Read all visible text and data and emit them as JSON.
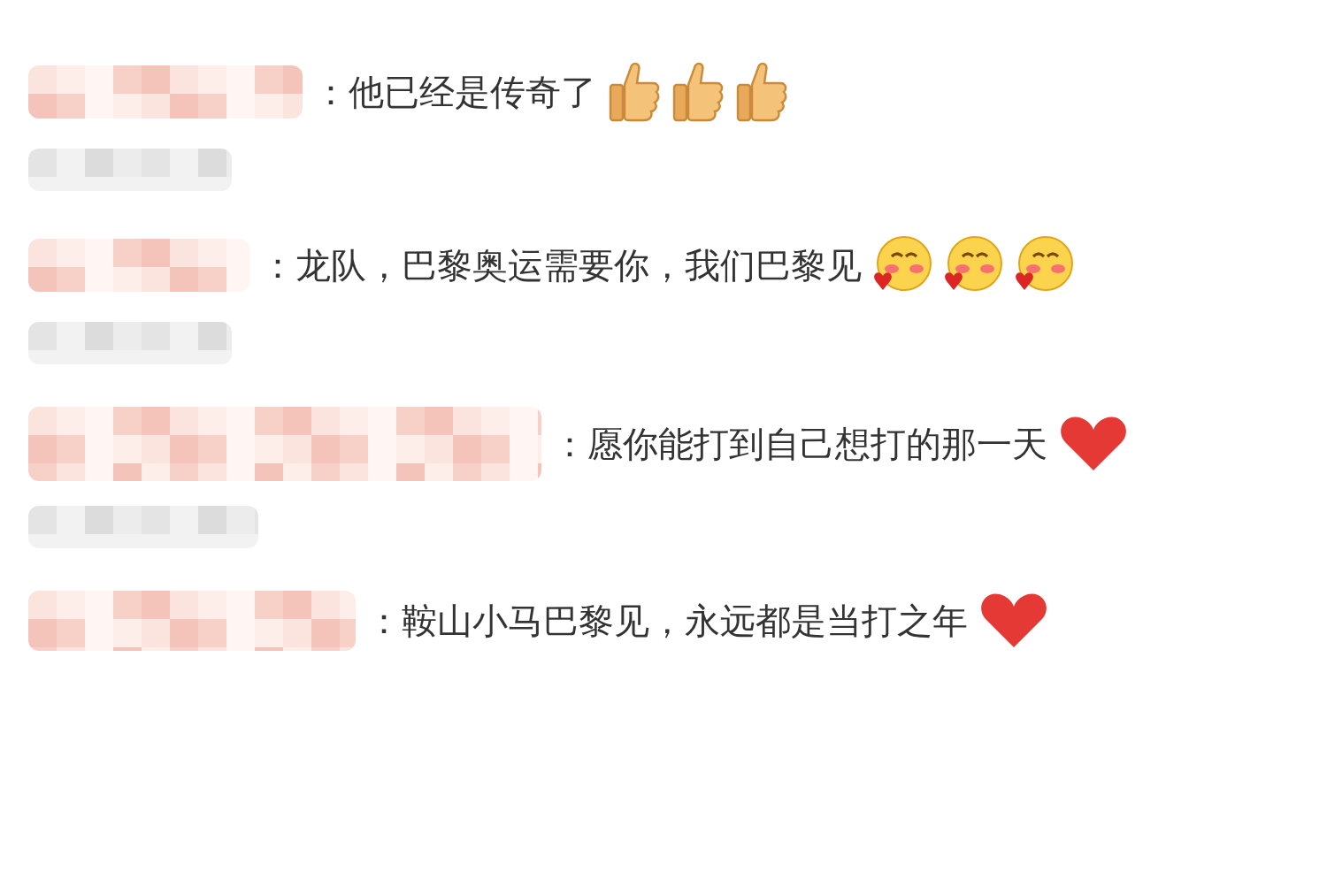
{
  "comments": [
    {
      "text": "：他已经是传奇了",
      "reactions": [
        {
          "kind": "thumbs"
        },
        {
          "kind": "thumbs"
        },
        {
          "kind": "thumbs"
        }
      ]
    },
    {
      "text": "：龙队，巴黎奥运需要你，我们巴黎见",
      "reactions": [
        {
          "kind": "blush"
        },
        {
          "kind": "blush"
        },
        {
          "kind": "blush"
        }
      ]
    },
    {
      "text": "：愿你能打到自己想打的那一天",
      "reactions": [
        {
          "kind": "heart"
        }
      ]
    },
    {
      "text": "：鞍山小马巴黎见，永远都是当打之年",
      "reactions": [
        {
          "kind": "heart"
        }
      ]
    }
  ]
}
